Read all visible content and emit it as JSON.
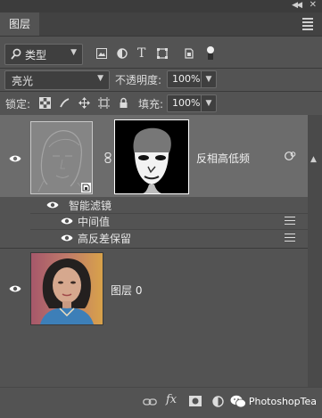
{
  "panel": {
    "tab_label": "图层"
  },
  "filter": {
    "kind_label": "类型"
  },
  "blend": {
    "mode": "亮光",
    "opacity_label": "不透明度:",
    "opacity_value": "100%"
  },
  "lock": {
    "label": "锁定:",
    "fill_label": "填充:",
    "fill_value": "100%"
  },
  "layers": {
    "smart_layer_name": "反相高低频",
    "smart_filters_label": "智能滤镜",
    "filter1_label": "中间值",
    "filter2_label": "高反差保留",
    "bg_layer_name": "图层 0"
  },
  "bottom": {
    "fx_label": "fx"
  },
  "watermark": {
    "text": "PhotoshopTea"
  },
  "colors": {
    "panel_bg": "#535353",
    "selected_row": "#6c6c6c",
    "text": "#f0f0f0"
  }
}
